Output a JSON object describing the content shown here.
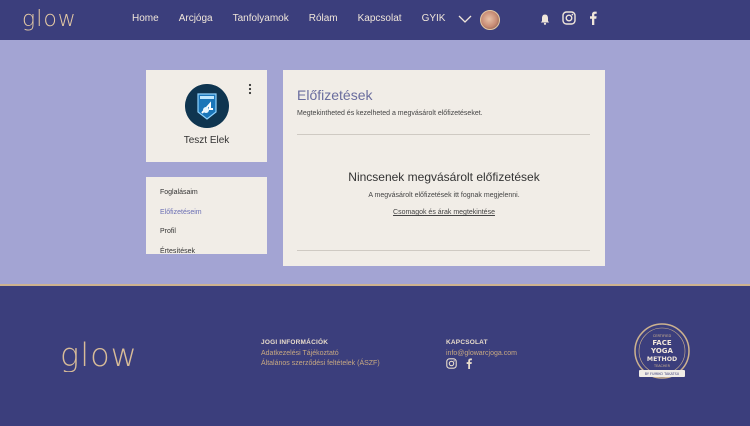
{
  "header": {
    "logo": "glow",
    "nav": [
      "Home",
      "Arcjóga",
      "Tanfolyamok",
      "Rólam",
      "Kapcsolat",
      "GYIK"
    ]
  },
  "profile": {
    "name": "Teszt Elek"
  },
  "menu": {
    "items": [
      {
        "label": "Foglalásaim",
        "active": false
      },
      {
        "label": "Előfizetéseim",
        "active": true
      },
      {
        "label": "Profil",
        "active": false
      },
      {
        "label": "Értesítések",
        "active": false
      }
    ]
  },
  "content": {
    "title": "Előfizetések",
    "subtitle": "Megtekintheted és kezelheted a megvásárolt előfizetéseket.",
    "empty_title": "Nincsenek megvásárolt előfizetések",
    "empty_desc": "A megvásárolt előfizetések itt fognak megjelenni.",
    "empty_link": "Csomagok és árak megtekintése"
  },
  "footer": {
    "logo": "glow",
    "legal": {
      "heading": "JOGI INFORMÁCIÓK",
      "links": [
        "Adatkezelési Tájékoztató",
        "Általános szerződési feltételek (ÁSZF)"
      ]
    },
    "contact": {
      "heading": "KAPCSOLAT",
      "email": "info@glowarcjoga.com"
    },
    "badge": {
      "top": "CERTIFIED",
      "line1": "FACE",
      "line2": "YOGA",
      "line3": "METHOD",
      "sub": "TEACHER",
      "ribbon": "BY FUMIKO TAKATSU"
    }
  },
  "colors": {
    "brand_dark": "#3b3e7c",
    "brand_light": "#a3a4d3",
    "gold": "#cdb28f",
    "card": "#f1ede7",
    "accent": "#6b6fb4"
  }
}
